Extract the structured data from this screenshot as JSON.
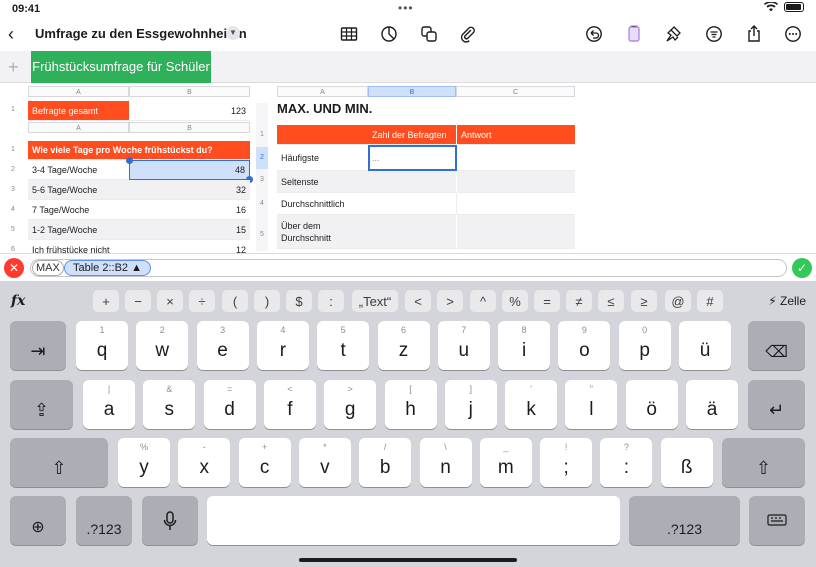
{
  "status": {
    "time": "09:41"
  },
  "toolbar": {
    "title": "Umfrage zu den Essgewohnheiten"
  },
  "tabs": {
    "active": "Frühstücksumfrage für Schüler"
  },
  "table1": {
    "col_a": "A",
    "col_b": "B",
    "label": "Befragte gesamt",
    "value": "123"
  },
  "table2": {
    "col_a": "A",
    "col_b": "B",
    "header": "Wie viele Tage pro Woche frühstückst du?",
    "rows": [
      {
        "label": "3-4 Tage/Woche",
        "value": "48"
      },
      {
        "label": "5-6 Tage/Woche",
        "value": "32"
      },
      {
        "label": "7 Tage/Woche",
        "value": "16"
      },
      {
        "label": "1-2 Tage/Woche",
        "value": "15"
      },
      {
        "label": "Ich frühstücke nicht",
        "value": "12"
      }
    ]
  },
  "table3": {
    "title": "MAX. UND MIN.",
    "col_a": "A",
    "col_b": "B",
    "col_c": "C",
    "head_b": "Zahl der Befragten",
    "head_c": "Antwort",
    "rows": [
      "Häufigste",
      "Seltenste",
      "Durchschnittlich",
      "Über dem Durchschnitt"
    ],
    "cell_b2": "..."
  },
  "formula": {
    "func": "MAX",
    "ref": "Table 2::B2 ▲"
  },
  "keyboard": {
    "ops": [
      "+",
      "−",
      "×",
      "÷",
      "(",
      ")",
      "$",
      ":",
      "„Text“",
      "<",
      ">",
      "^",
      "%",
      "=",
      "≠",
      "≤",
      "≥",
      "@",
      "#"
    ],
    "zelle": "Zelle",
    "row1": [
      {
        "k": "q",
        "s": "1"
      },
      {
        "k": "w",
        "s": "2"
      },
      {
        "k": "e",
        "s": "3"
      },
      {
        "k": "r",
        "s": "4"
      },
      {
        "k": "t",
        "s": "5"
      },
      {
        "k": "z",
        "s": "6"
      },
      {
        "k": "u",
        "s": "7"
      },
      {
        "k": "i",
        "s": "8"
      },
      {
        "k": "o",
        "s": "9"
      },
      {
        "k": "p",
        "s": "0"
      },
      {
        "k": "ü",
        "s": ""
      }
    ],
    "row2": [
      {
        "k": "a",
        "s": "|"
      },
      {
        "k": "s",
        "s": "&"
      },
      {
        "k": "d",
        "s": "="
      },
      {
        "k": "f",
        "s": "<"
      },
      {
        "k": "g",
        "s": ">"
      },
      {
        "k": "h",
        "s": "["
      },
      {
        "k": "j",
        "s": "]"
      },
      {
        "k": "k",
        "s": "'"
      },
      {
        "k": "l",
        "s": "\""
      },
      {
        "k": "ö",
        "s": ""
      },
      {
        "k": "ä",
        "s": ""
      }
    ],
    "row3": [
      {
        "k": "y",
        "s": "%"
      },
      {
        "k": "x",
        "s": "-"
      },
      {
        "k": "c",
        "s": "+"
      },
      {
        "k": "v",
        "s": "*"
      },
      {
        "k": "b",
        "s": "/"
      },
      {
        "k": "n",
        "s": "\\"
      },
      {
        "k": "m",
        "s": "_"
      },
      {
        "k": ";",
        "s": "!"
      },
      {
        "k": ":",
        "s": "?"
      },
      {
        "k": "ß",
        "s": ""
      }
    ],
    "num_label": ".?123"
  }
}
